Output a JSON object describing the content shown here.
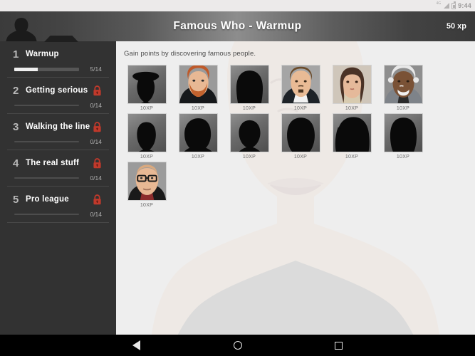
{
  "statusbar": {
    "network": "4G",
    "time": "9:44",
    "signal_icon": "signal-icon",
    "battery_icon": "battery-icon"
  },
  "header": {
    "avatar_icon": "avatar-silhouette-icon",
    "title": "Famous Who - Warmup",
    "xp": "50 xp"
  },
  "sidebar": {
    "lessons": [
      {
        "number": "1",
        "title": "Warmup",
        "progress": "5/14",
        "percent": 36,
        "locked": false,
        "lock_icon": "lock-icon"
      },
      {
        "number": "2",
        "title": "Getting serious",
        "progress": "0/14",
        "percent": 0,
        "locked": true,
        "lock_icon": "lock-icon"
      },
      {
        "number": "3",
        "title": "Walking the line",
        "progress": "0/14",
        "percent": 0,
        "locked": true,
        "lock_icon": "lock-icon"
      },
      {
        "number": "4",
        "title": "The real stuff",
        "progress": "0/14",
        "percent": 0,
        "locked": true,
        "lock_icon": "lock-icon"
      },
      {
        "number": "5",
        "title": "Pro league",
        "progress": "0/14",
        "percent": 0,
        "locked": true,
        "lock_icon": "lock-icon"
      }
    ]
  },
  "main": {
    "subtitle": "Gain points by discovering famous people.",
    "background_icon": "large-face-illustration",
    "cards": [
      {
        "xp": "10XP",
        "revealed": false,
        "silhouette": "hat-man"
      },
      {
        "xp": "10XP",
        "revealed": true,
        "portrait": "red-bearded-man"
      },
      {
        "xp": "10XP",
        "revealed": false,
        "silhouette": "long-hair-woman"
      },
      {
        "xp": "10XP",
        "revealed": true,
        "portrait": "brown-haired-man-suit"
      },
      {
        "xp": "10XP",
        "revealed": true,
        "portrait": "long-haired-woman"
      },
      {
        "xp": "10XP",
        "revealed": true,
        "portrait": "white-haired-older-man"
      },
      {
        "xp": "10XP",
        "revealed": false,
        "silhouette": "short-hair-man"
      },
      {
        "xp": "10XP",
        "revealed": false,
        "silhouette": "curly-hair-person"
      },
      {
        "xp": "10XP",
        "revealed": false,
        "silhouette": "bald-man"
      },
      {
        "xp": "10XP",
        "revealed": false,
        "silhouette": "wavy-hair-person"
      },
      {
        "xp": "10XP",
        "revealed": false,
        "silhouette": "side-hair-woman"
      },
      {
        "xp": "10XP",
        "revealed": false,
        "silhouette": "shoulder-hair-person"
      },
      {
        "xp": "10XP",
        "revealed": true,
        "portrait": "bald-man-glasses"
      }
    ]
  },
  "navbar": {
    "back_icon": "back-triangle-icon",
    "home_icon": "home-circle-icon",
    "recents_icon": "recents-square-icon"
  },
  "colors": {
    "sidebar_bg": "#323232",
    "main_bg": "#eeeeee",
    "lock_red": "#c0392b",
    "accent_white": "#f0f0f0"
  }
}
